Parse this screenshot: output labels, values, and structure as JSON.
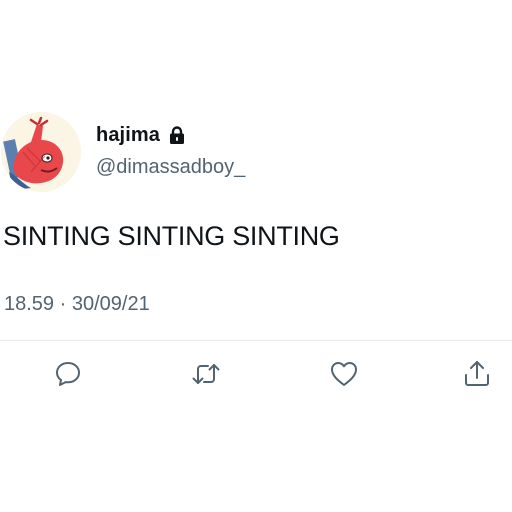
{
  "tweet": {
    "display_name": "hajima",
    "handle": "@dimassadboy_",
    "text": "SINTING SINTING SINTING",
    "time": "18.59",
    "separator": "·",
    "date": "30/09/21",
    "icons": {
      "lock": "lock-icon",
      "reply": "reply-icon",
      "retweet": "retweet-icon",
      "like": "heart-icon",
      "share": "share-icon"
    }
  }
}
